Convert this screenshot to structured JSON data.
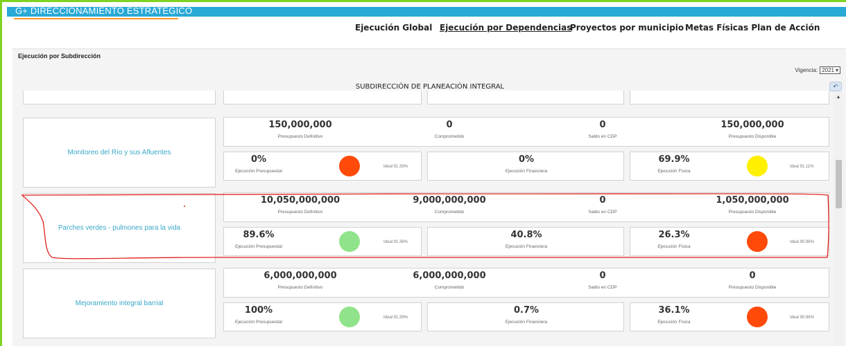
{
  "app": {
    "title": "G+ DIRECCIONAMIENTO ESTRATÉGICO"
  },
  "nav": {
    "items": [
      {
        "label": "Ejecución Global",
        "active": false
      },
      {
        "label": "Ejecución por Dependencias",
        "active": true
      },
      {
        "label": "Proyectos por municipio",
        "active": false
      },
      {
        "label": "Metas Físicas Plan de Acción",
        "active": false
      }
    ]
  },
  "panel": {
    "header": "Ejecución por Subdirección"
  },
  "vigencia": {
    "label": "Vigencia:",
    "value": "2021"
  },
  "section_title": "SUBDIRECCIÓN DE PLANEACIÓN INTEGRAL",
  "labels": {
    "presupuesto_definitivo": "Presupuesto Definitivo",
    "comprometido": "Comprometido",
    "saldo_cdp": "Saldo en CDP",
    "presupuesto_disponible": "Presupuesto Disponible",
    "ejecucion_presupuestal": "Ejecución Presupuestal",
    "ejecucion_financiera": "Ejecución Financiera",
    "ejecucion_fisica": "Ejecución Física"
  },
  "colors": {
    "green": "#90e38a",
    "red": "#ff4a0a",
    "yellow": "#fff000",
    "link": "#39a7c8",
    "annotation": "#e0201a"
  },
  "projects": [
    {
      "name": "Monitoreo del Río y sus Afluentes",
      "presupuesto_definitivo": "150,000,000",
      "comprometido": "0",
      "saldo_cdp": "0",
      "presupuesto_disponible": "150,000,000",
      "ejec_presupuestal": "0%",
      "ideal_presupuestal": "Ideal 91.39%",
      "status_presupuestal": "red",
      "ejec_financiera": "0%",
      "ejec_fisica": "69.9%",
      "ideal_fisica": "Ideal 91.11%",
      "status_fisica": "yellow"
    },
    {
      "name": "Parches verdes - pulmones para la vida",
      "presupuesto_definitivo": "10,050,000,000",
      "comprometido": "9,000,000,000",
      "saldo_cdp": "0",
      "presupuesto_disponible": "1,050,000,000",
      "ejec_presupuestal": "89.6%",
      "ideal_presupuestal": "Ideal 91.39%",
      "status_presupuestal": "green",
      "ejec_financiera": "40.8%",
      "ejec_fisica": "26.3%",
      "ideal_fisica": "Ideal 90.96%",
      "status_fisica": "red"
    },
    {
      "name": "Mejoramiento integral barrial",
      "presupuesto_definitivo": "6,000,000,000",
      "comprometido": "6,000,000,000",
      "saldo_cdp": "0",
      "presupuesto_disponible": "0",
      "ejec_presupuestal": "100%",
      "ideal_presupuestal": "Ideal 91.39%",
      "status_presupuestal": "green",
      "ejec_financiera": "0.7%",
      "ejec_fisica": "36.1%",
      "ideal_fisica": "Ideal 90.96%",
      "status_fisica": "red"
    }
  ]
}
